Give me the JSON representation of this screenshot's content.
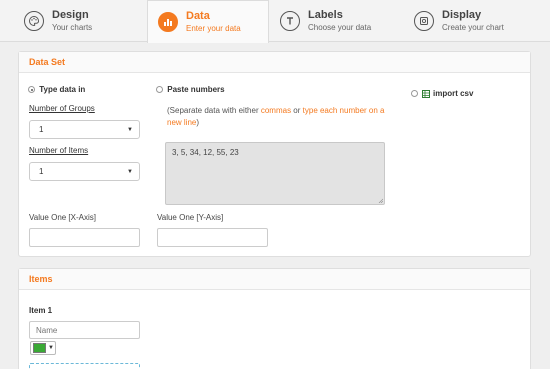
{
  "tabs": [
    {
      "title": "Design",
      "sub": "Your charts",
      "icon": "palette-icon"
    },
    {
      "title": "Data",
      "sub": "Enter your data",
      "icon": "bar-chart-icon"
    },
    {
      "title": "Labels",
      "sub": "Choose your data",
      "icon": "text-icon"
    },
    {
      "title": "Display",
      "sub": "Create your chart",
      "icon": "display-icon"
    }
  ],
  "dataset": {
    "heading": "Data Set",
    "type_data_label": "Type data in",
    "paste_label": "Paste numbers",
    "paste_hint_a": "(Separate data with either ",
    "paste_hint_commas": "commas",
    "paste_hint_or": " or ",
    "paste_hint_each": "type each number on a new line",
    "paste_hint_end": ")",
    "paste_value": "3, 5, 34, 12, 55, 23",
    "import_label": "import csv",
    "groups_label": "Number of Groups",
    "groups_value": "1",
    "items_label": "Number of Items",
    "items_value": "1",
    "x_axis_label": "Value One [X-Axis]",
    "y_axis_label": "Value One [Y-Axis]"
  },
  "items": {
    "heading": "Items",
    "item_title": "Item 1",
    "name_placeholder": "Name",
    "swatch_color": "#3aa935"
  },
  "colors": {
    "accent": "#f47a20"
  }
}
